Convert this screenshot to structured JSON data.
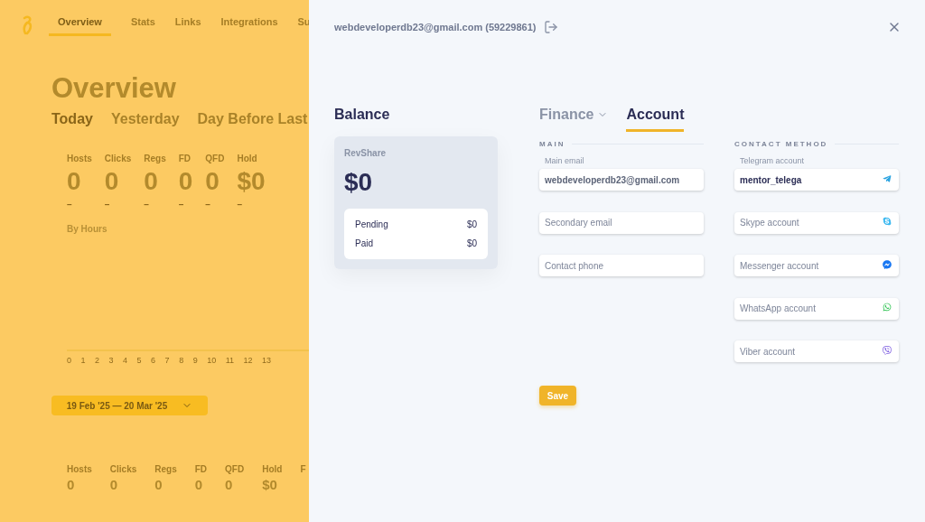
{
  "background": {
    "nav": [
      {
        "label": "Overview",
        "selected": true
      },
      {
        "label": "Stats",
        "selected": false
      },
      {
        "label": "Links",
        "selected": false
      },
      {
        "label": "Integrations",
        "selected": false
      },
      {
        "label": "Su",
        "selected": false
      }
    ],
    "title": "Overview",
    "periods": [
      {
        "label": "Today",
        "selected": true
      },
      {
        "label": "Yesterday",
        "selected": false
      },
      {
        "label": "Day Before Last",
        "selected": false
      }
    ],
    "stats": [
      {
        "label": "Hosts",
        "value": "0",
        "change": "–"
      },
      {
        "label": "Clicks",
        "value": "0",
        "change": "–"
      },
      {
        "label": "Regs",
        "value": "0",
        "change": "–"
      },
      {
        "label": "FD",
        "value": "0",
        "change": "–"
      },
      {
        "label": "QFD",
        "value": "0",
        "change": "–"
      },
      {
        "label": "Hold",
        "value": "$0",
        "change": "–"
      }
    ],
    "chart_title": "By Hours",
    "hours": [
      "0",
      "1",
      "2",
      "3",
      "4",
      "5",
      "6",
      "7",
      "8",
      "9",
      "10",
      "11",
      "12",
      "13"
    ],
    "date_range": "19 Feb '25 — 20 Mar '25",
    "stats_2": [
      {
        "label": "Hosts",
        "value": "0"
      },
      {
        "label": "Clicks",
        "value": "0"
      },
      {
        "label": "Regs",
        "value": "0"
      },
      {
        "label": "FD",
        "value": "0"
      },
      {
        "label": "QFD",
        "value": "0"
      },
      {
        "label": "Hold",
        "value": "$0"
      },
      {
        "label": "F"
      }
    ]
  },
  "panel": {
    "user": "webdeveloperdb23@gmail.com (59229861)",
    "balance": {
      "title": "Balance",
      "type": "RevShare",
      "amount": "$0",
      "rows": [
        {
          "label": "Pending",
          "value": "$0"
        },
        {
          "label": "Paid",
          "value": "$0"
        }
      ]
    },
    "tabs": [
      {
        "label": "Finance",
        "selected": false,
        "dropdown": true
      },
      {
        "label": "Account",
        "selected": true,
        "dropdown": false
      }
    ],
    "main": {
      "heading": "MAIN",
      "fields": [
        {
          "label": "Main email",
          "value": "webdeveloperdb23@gmail.com"
        },
        {
          "placeholder": "Secondary email"
        },
        {
          "placeholder": "Contact phone"
        }
      ]
    },
    "contact": {
      "heading": "CONTACT METHOD",
      "fields": [
        {
          "kind": "telegram",
          "label": "Telegram account",
          "value": "mentor_telega"
        },
        {
          "kind": "skype",
          "placeholder": "Skype account"
        },
        {
          "kind": "messenger",
          "placeholder": "Messenger account"
        },
        {
          "kind": "whatsapp",
          "placeholder": "WhatsApp account"
        },
        {
          "kind": "viber",
          "placeholder": "Viber account"
        }
      ]
    },
    "save": "Save"
  }
}
